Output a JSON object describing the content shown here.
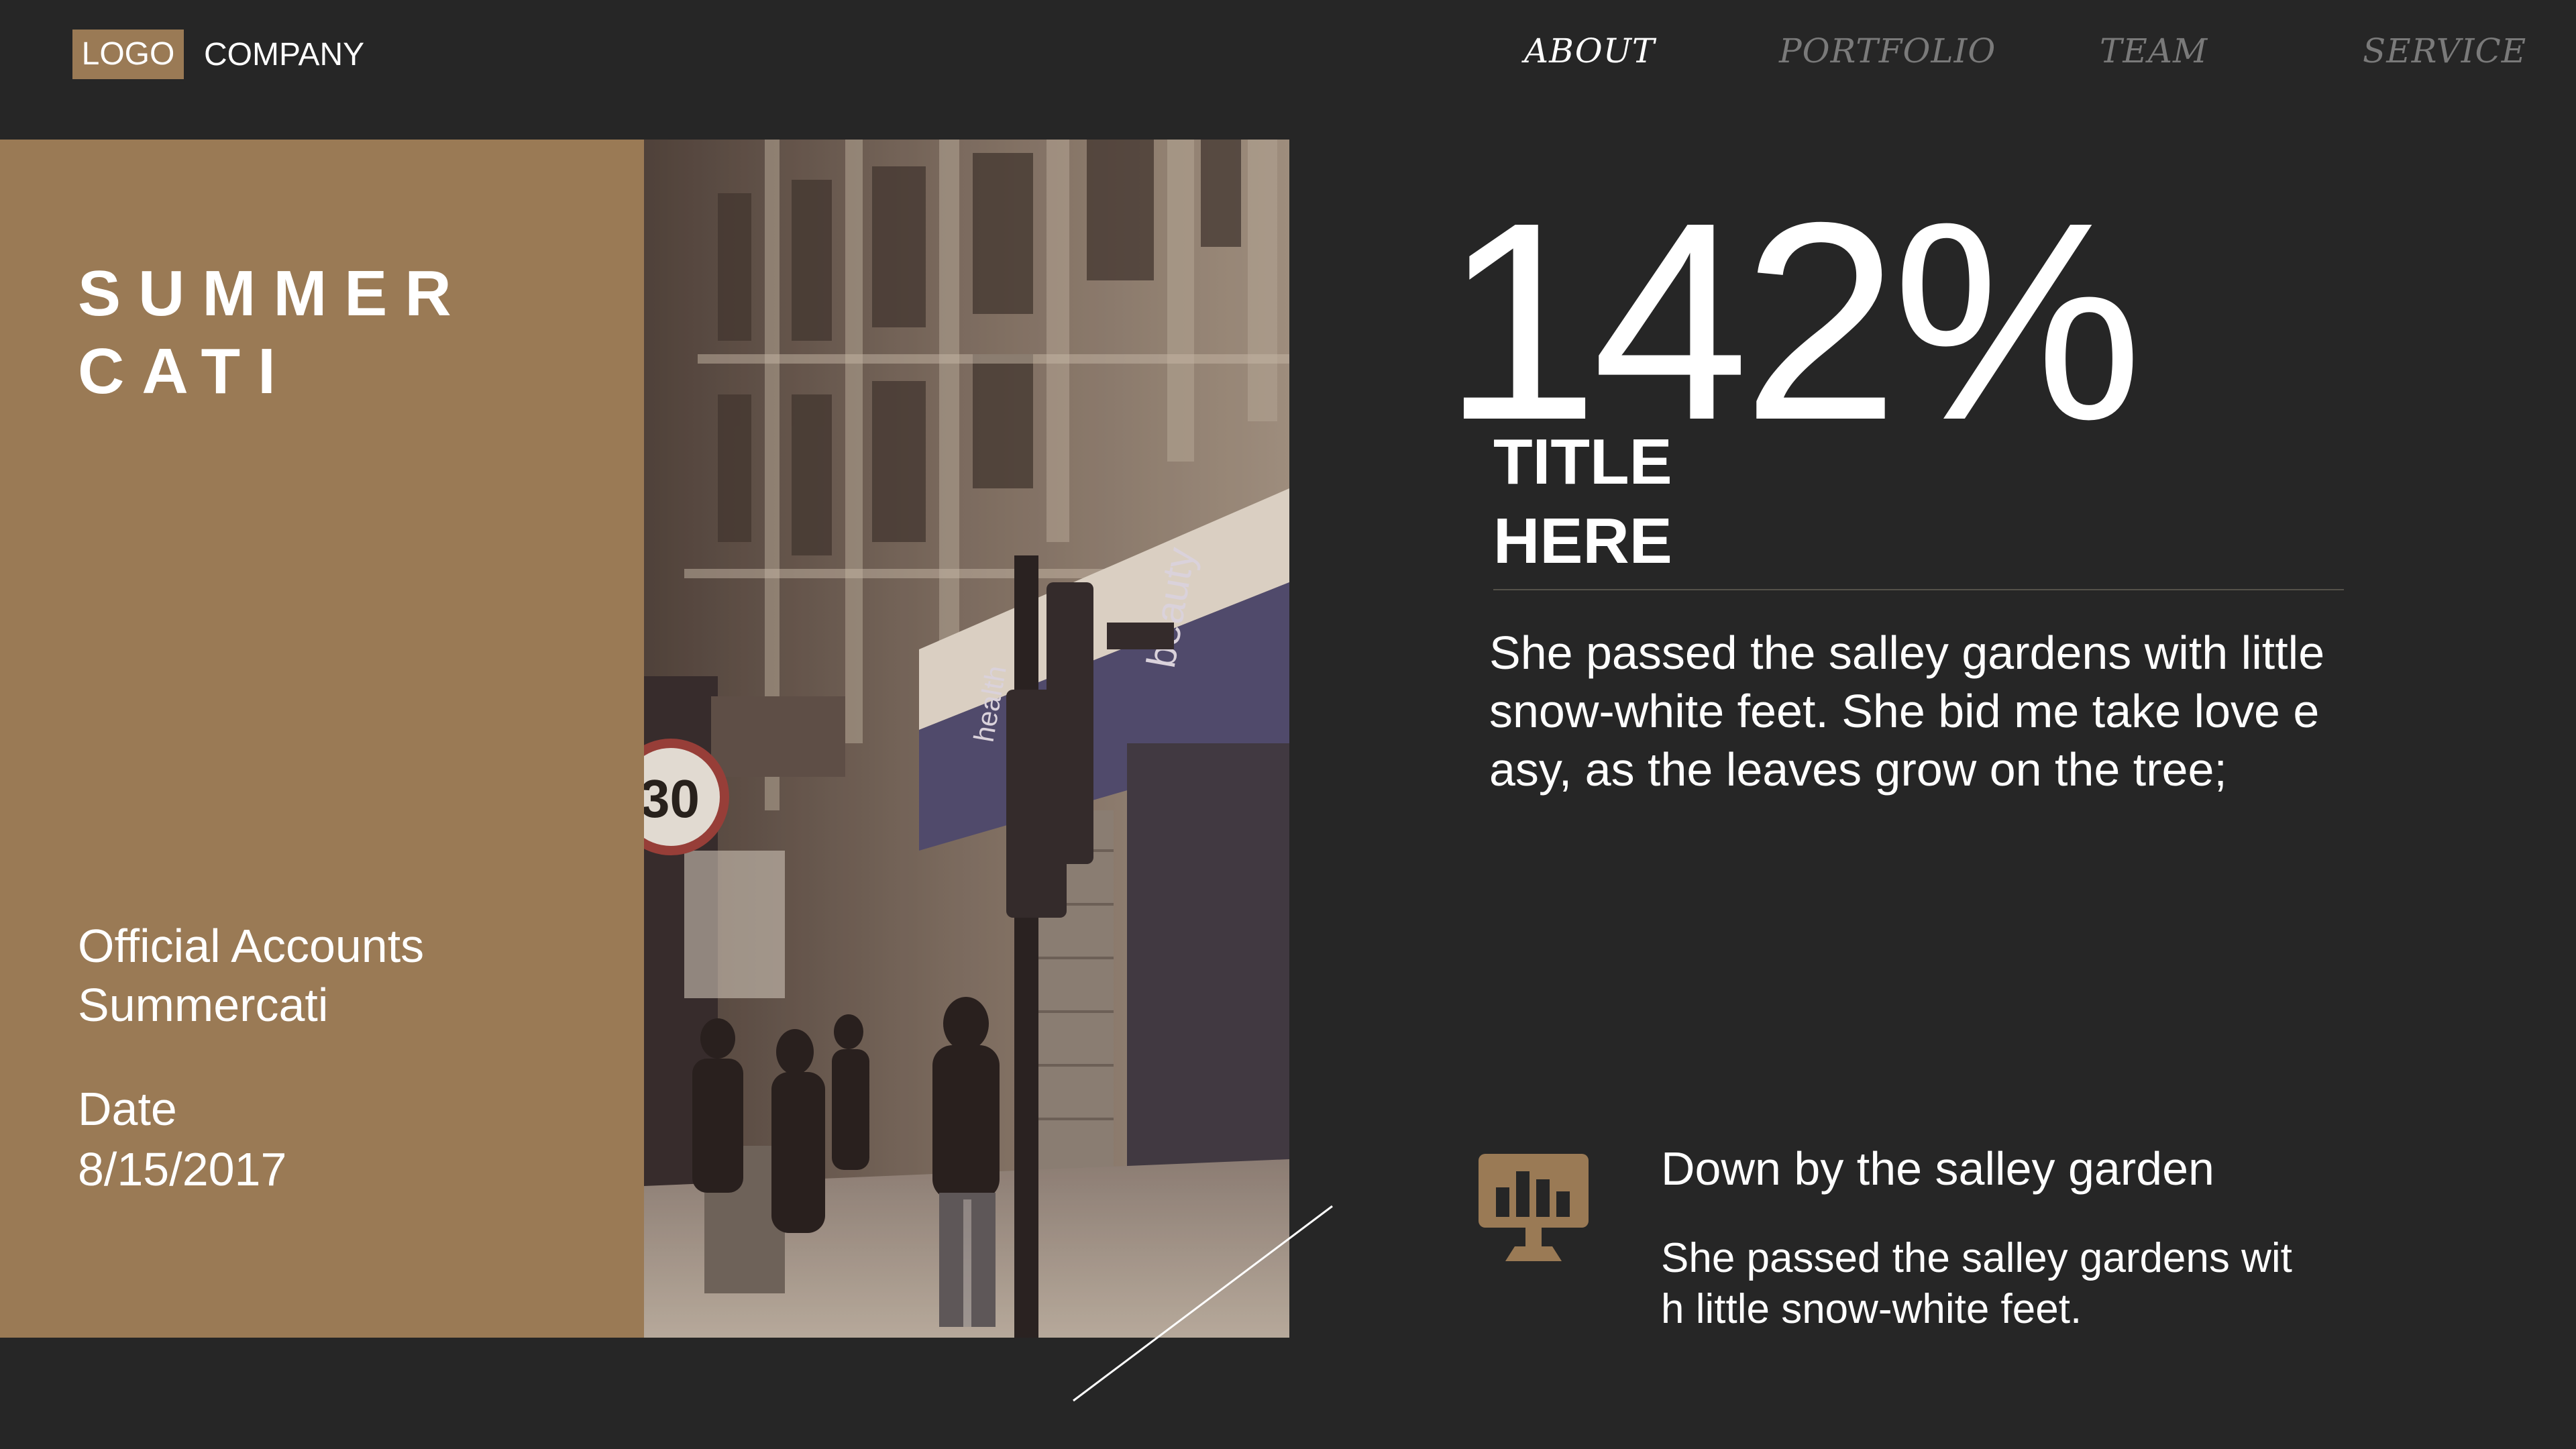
{
  "header": {
    "logo": "LOGO",
    "company": "COMPANY",
    "nav": [
      "ABOUT",
      "PORTFOLIO",
      "TEAM",
      "SERVICE"
    ],
    "active_nav": "ABOUT"
  },
  "panel": {
    "title_lines": [
      "SUMMER",
      "CATI"
    ],
    "accounts_lines": [
      "Official Accounts",
      "Summercati"
    ],
    "date_lines": [
      "Date",
      "8/15/2017"
    ]
  },
  "photo": {
    "sign_speed": "30",
    "sign_health": "health",
    "sign_beauty": "beauty"
  },
  "stat": {
    "value": "142%",
    "title_lines": [
      "TITLE",
      "HERE"
    ],
    "paragraph_lines": [
      "She passed the salley gardens with little",
      "snow-white feet. She bid me take love e",
      "asy, as the leaves grow on the tree;"
    ]
  },
  "feature": {
    "icon": "monitor-bar-chart-icon",
    "title": "Down by the salley garden",
    "text_lines": [
      "She passed the salley gardens wit",
      "h little snow-white feet."
    ]
  },
  "colors": {
    "background": "#262626",
    "accent": "#9a7a55",
    "nav_inactive": "#7a7a7a",
    "text": "#ffffff"
  }
}
